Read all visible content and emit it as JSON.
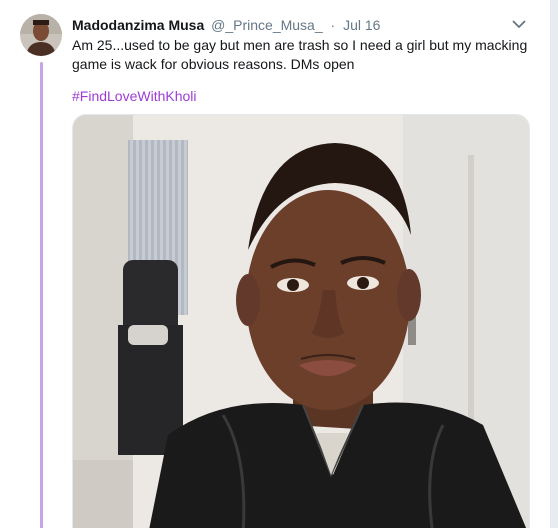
{
  "tweet": {
    "author_name": "Madodanzima Musa",
    "author_handle": "@_Prince_Musa_",
    "separator": "·",
    "date": "Jul 16",
    "text": "Am 25...used to be gay but men are trash so I need a girl but my macking game is wack for obvious reasons. DMs open",
    "hashtag": "#FindLoveWithKholi"
  },
  "icons": {
    "menu": "chevron-down-icon"
  },
  "colors": {
    "name": "#14171a",
    "meta": "#657786",
    "hashtag": "#9d3cd6",
    "thread_line": "#c9a3e5",
    "page_bg": "#e6ecf0"
  }
}
